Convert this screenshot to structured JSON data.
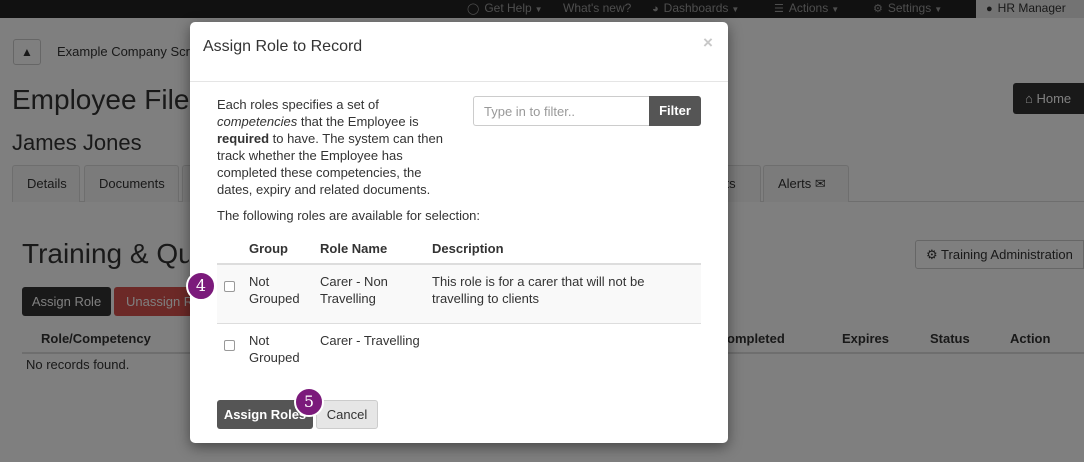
{
  "navbar": {
    "items": [
      {
        "label": "Get Help",
        "icon": "help-circle-icon",
        "caret": true
      },
      {
        "label": "What's new?",
        "icon": "",
        "caret": false
      },
      {
        "label": "Dashboards",
        "icon": "dashboard-icon",
        "caret": true
      },
      {
        "label": "Actions",
        "icon": "list-icon",
        "caret": true
      },
      {
        "label": "Settings",
        "icon": "gears-icon",
        "caret": true
      }
    ],
    "user": {
      "label": "HR Manager",
      "icon": "user-icon"
    }
  },
  "page": {
    "company": "Example Company Scre",
    "title": "Employee File",
    "person": "James Jones",
    "home_label": "Home",
    "tabs": [
      "Details",
      "Documents",
      "",
      "sts",
      "Alerts"
    ],
    "section_title": "Training & Qu",
    "training_admin_label": "Training Administration",
    "assign_label": "Assign Role",
    "unassign_label": "Unassign R",
    "table_headers": [
      "Role/Competency",
      "ompleted",
      "Expires",
      "Status",
      "Action"
    ],
    "no_records": "No records found."
  },
  "modal": {
    "title": "Assign Role to Record",
    "close": "×",
    "description": {
      "p1": "Each roles specifies a set of ",
      "em": "competencies",
      "p2": " that the Employee is ",
      "strong": "required",
      "p3": " to have. The system can then track whether the Employee has completed these competencies, the dates, expiry and related documents."
    },
    "filter_placeholder": "Type in to filter..",
    "filter_button": "Filter",
    "available_text": "The following roles are available for selection:",
    "headers": {
      "group": "Group",
      "role_name": "Role Name",
      "description": "Description"
    },
    "rows": [
      {
        "group": "Not Grouped",
        "role_name": "Carer - Non Travelling",
        "description": "This role is for a carer that will not be travelling to clients",
        "checked": false
      },
      {
        "group": "Not Grouped",
        "role_name": "Carer - Travelling",
        "description": "",
        "checked": false
      }
    ],
    "assign_button": "Assign Roles",
    "cancel_button": "Cancel"
  },
  "badges": [
    "4",
    "5"
  ],
  "colors": {
    "badge": "#7b1a7b",
    "danger": "#d9534f",
    "dark_button": "#333333",
    "navbar": "#222222"
  }
}
